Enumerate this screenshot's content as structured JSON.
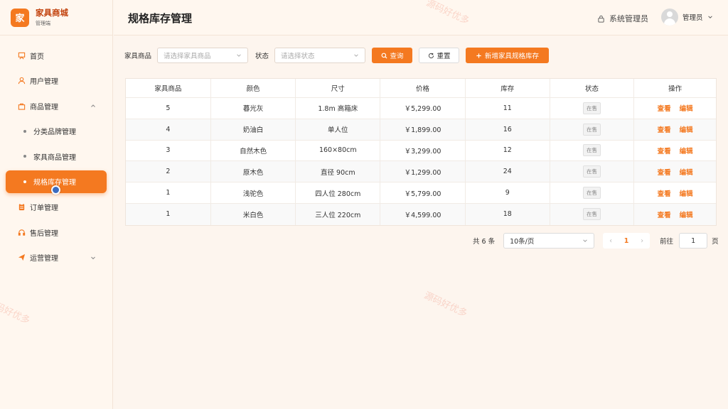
{
  "brand": {
    "logo_char": "家",
    "title": "家具商城",
    "subtitle": "管理端"
  },
  "menu": {
    "home": "首页",
    "users": "用户管理",
    "products": "商品管理",
    "category_brand": "分类品牌管理",
    "furniture_products": "家具商品管理",
    "spec_stock": "规格库存管理",
    "orders": "订单管理",
    "after_sales": "售后管理",
    "operations": "运营管理"
  },
  "header": {
    "title": "规格库存管理",
    "role": "系统管理员",
    "user": "管理员"
  },
  "filters": {
    "product_label": "家具商品",
    "product_placeholder": "请选择家具商品",
    "status_label": "状态",
    "status_placeholder": "请选择状态",
    "query": "查询",
    "reset": "重置",
    "add": "新增家具规格库存"
  },
  "table": {
    "columns": [
      "家具商品",
      "颜色",
      "尺寸",
      "价格",
      "库存",
      "状态",
      "操作"
    ],
    "rows": [
      {
        "product": "5",
        "color": "暮光灰",
        "size": "1.8m 高箱床",
        "price": "￥5,299.00",
        "stock": "11",
        "status": "在售"
      },
      {
        "product": "4",
        "color": "奶油白",
        "size": "单人位",
        "price": "￥1,899.00",
        "stock": "16",
        "status": "在售"
      },
      {
        "product": "3",
        "color": "自然木色",
        "size": "160×80cm",
        "price": "￥3,299.00",
        "stock": "12",
        "status": "在售"
      },
      {
        "product": "2",
        "color": "原木色",
        "size": "直径 90cm",
        "price": "￥1,299.00",
        "stock": "24",
        "status": "在售"
      },
      {
        "product": "1",
        "color": "浅驼色",
        "size": "四人位 280cm",
        "price": "￥5,799.00",
        "stock": "9",
        "status": "在售"
      },
      {
        "product": "1",
        "color": "米白色",
        "size": "三人位 220cm",
        "price": "￥4,599.00",
        "stock": "18",
        "status": "在售"
      }
    ],
    "view": "查看",
    "edit": "编辑"
  },
  "pagination": {
    "total": "共 6 条",
    "page_size": "10条/页",
    "current": "1",
    "goto_label": "前往",
    "goto_value": "1",
    "page_suffix": "页"
  },
  "watermark": "源码好优多",
  "colors": {
    "accent": "#f47920",
    "background": "#fdf5ee"
  }
}
